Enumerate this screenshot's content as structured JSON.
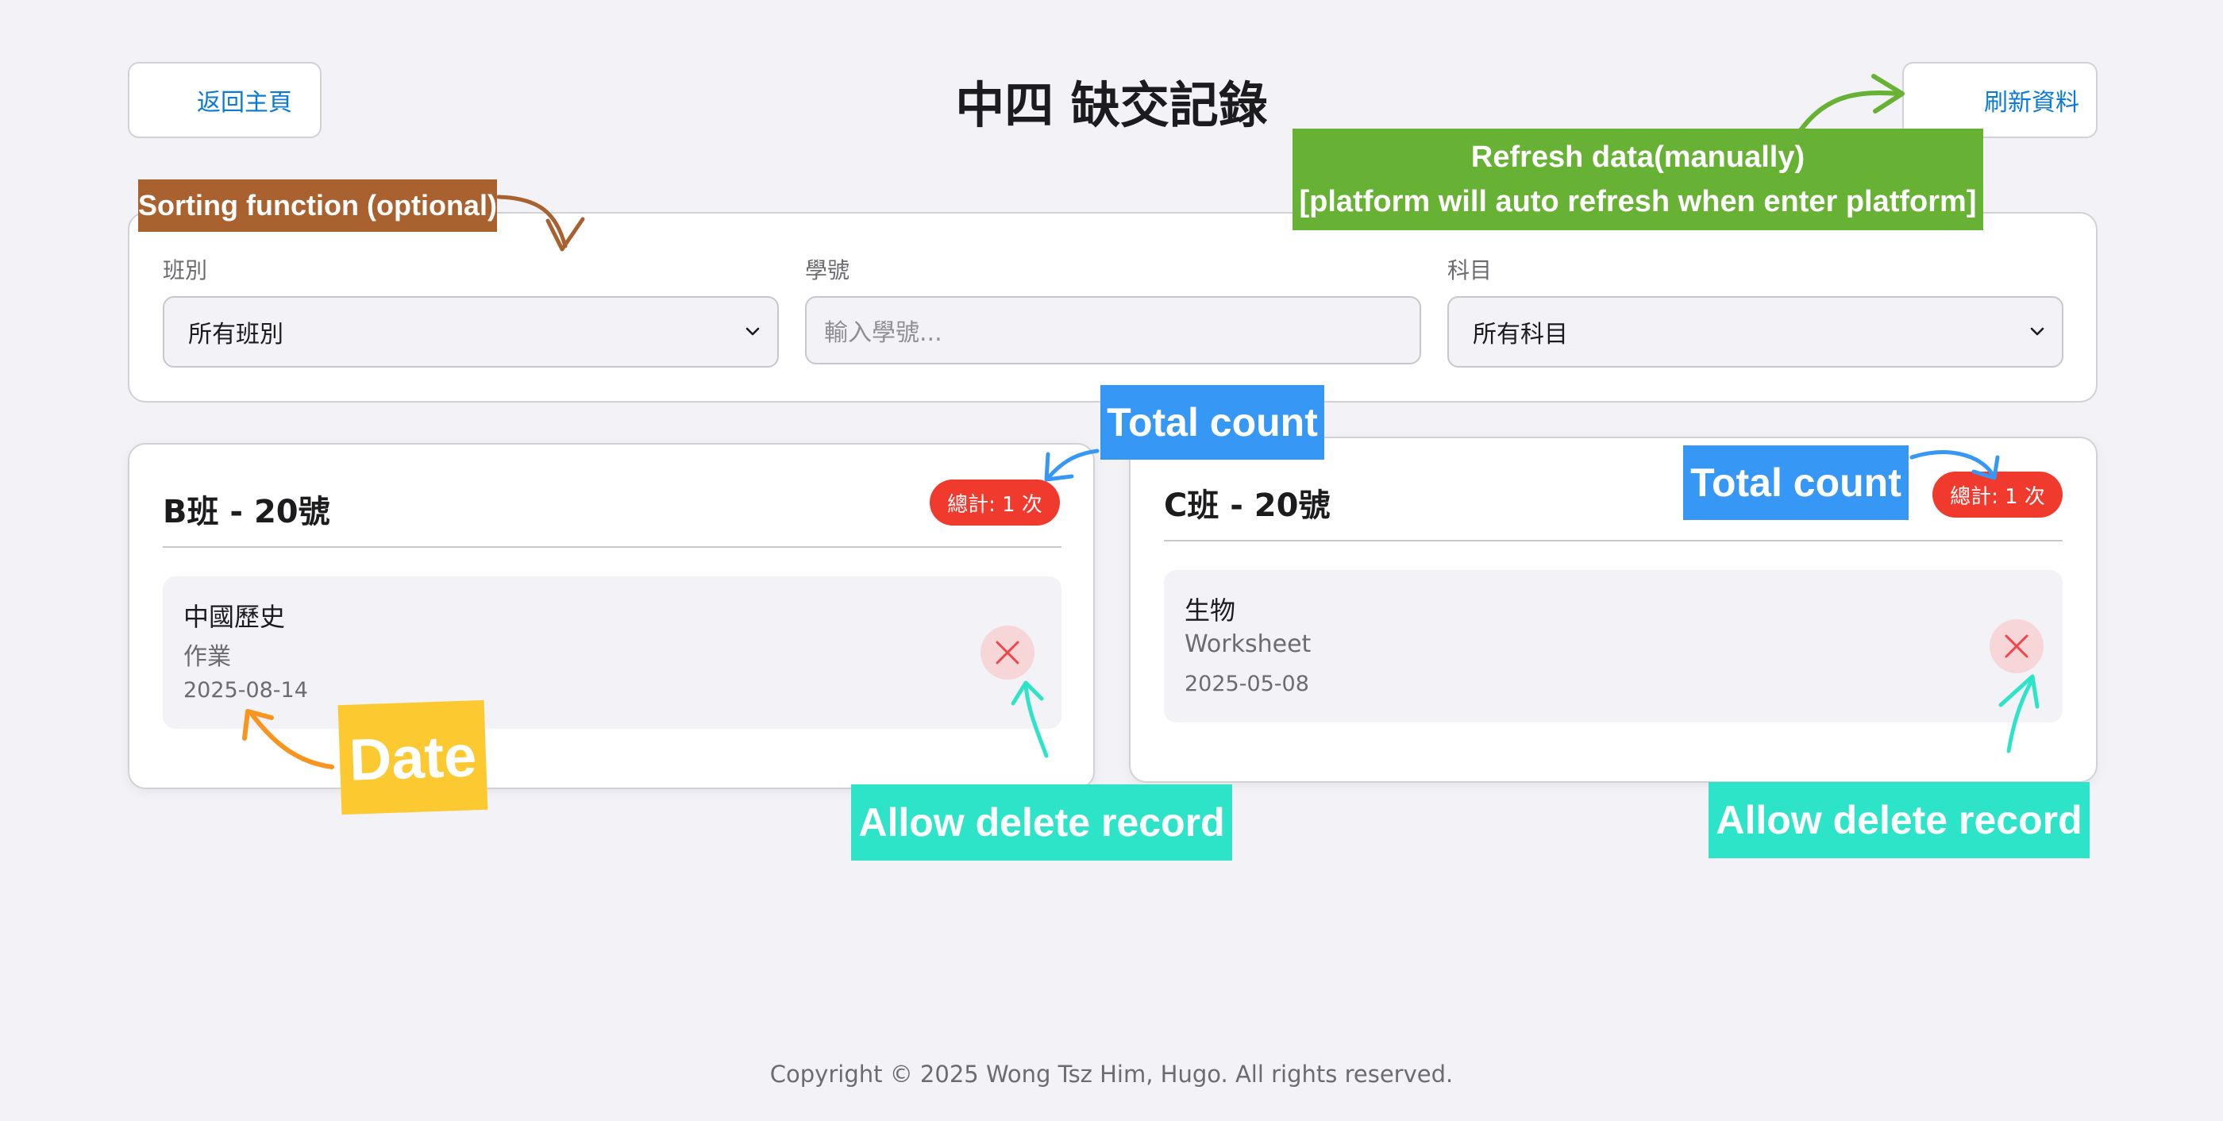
{
  "header": {
    "back_label": "返回主頁",
    "title": "中四 缺交記錄",
    "refresh_label": "刷新資料"
  },
  "filters": {
    "class_label": "班別",
    "class_value": "所有班別",
    "student_label": "學號",
    "student_placeholder": "輸入學號...",
    "subject_label": "科目",
    "subject_value": "所有科目"
  },
  "cards": [
    {
      "title": "B班 - 20號",
      "badge": "總計: 1 次",
      "entries": [
        {
          "subject": "中國歷史",
          "type": "作業",
          "date": "2025-08-14"
        }
      ]
    },
    {
      "title": "C班 - 20號",
      "badge": "總計: 1 次",
      "entries": [
        {
          "subject": "生物",
          "type": "Worksheet",
          "date": "2025-05-08"
        }
      ]
    }
  ],
  "footer": "Copyright © 2025 Wong Tsz Him, Hugo. All rights reserved.",
  "annotations": {
    "sorting": "Sorting function (optional)",
    "refresh_line1": "Refresh data(manually)",
    "refresh_line2": "[platform will auto refresh when enter platform]",
    "total_count": "Total count",
    "date": "Date",
    "allow_delete": "Allow delete record"
  },
  "colors": {
    "background": "#f2f2f7",
    "link_blue": "#0a7ad6",
    "badge_red": "#f03a2e",
    "delete_bg": "#f7d6d8",
    "note_sort": "#a9612f",
    "note_refresh": "#67b234",
    "note_total": "#3797f5",
    "note_date": "#fdc931",
    "note_delete": "#2ee4c8"
  },
  "icons": {
    "delete": "close-icon",
    "select": "chevron-down-icon"
  }
}
